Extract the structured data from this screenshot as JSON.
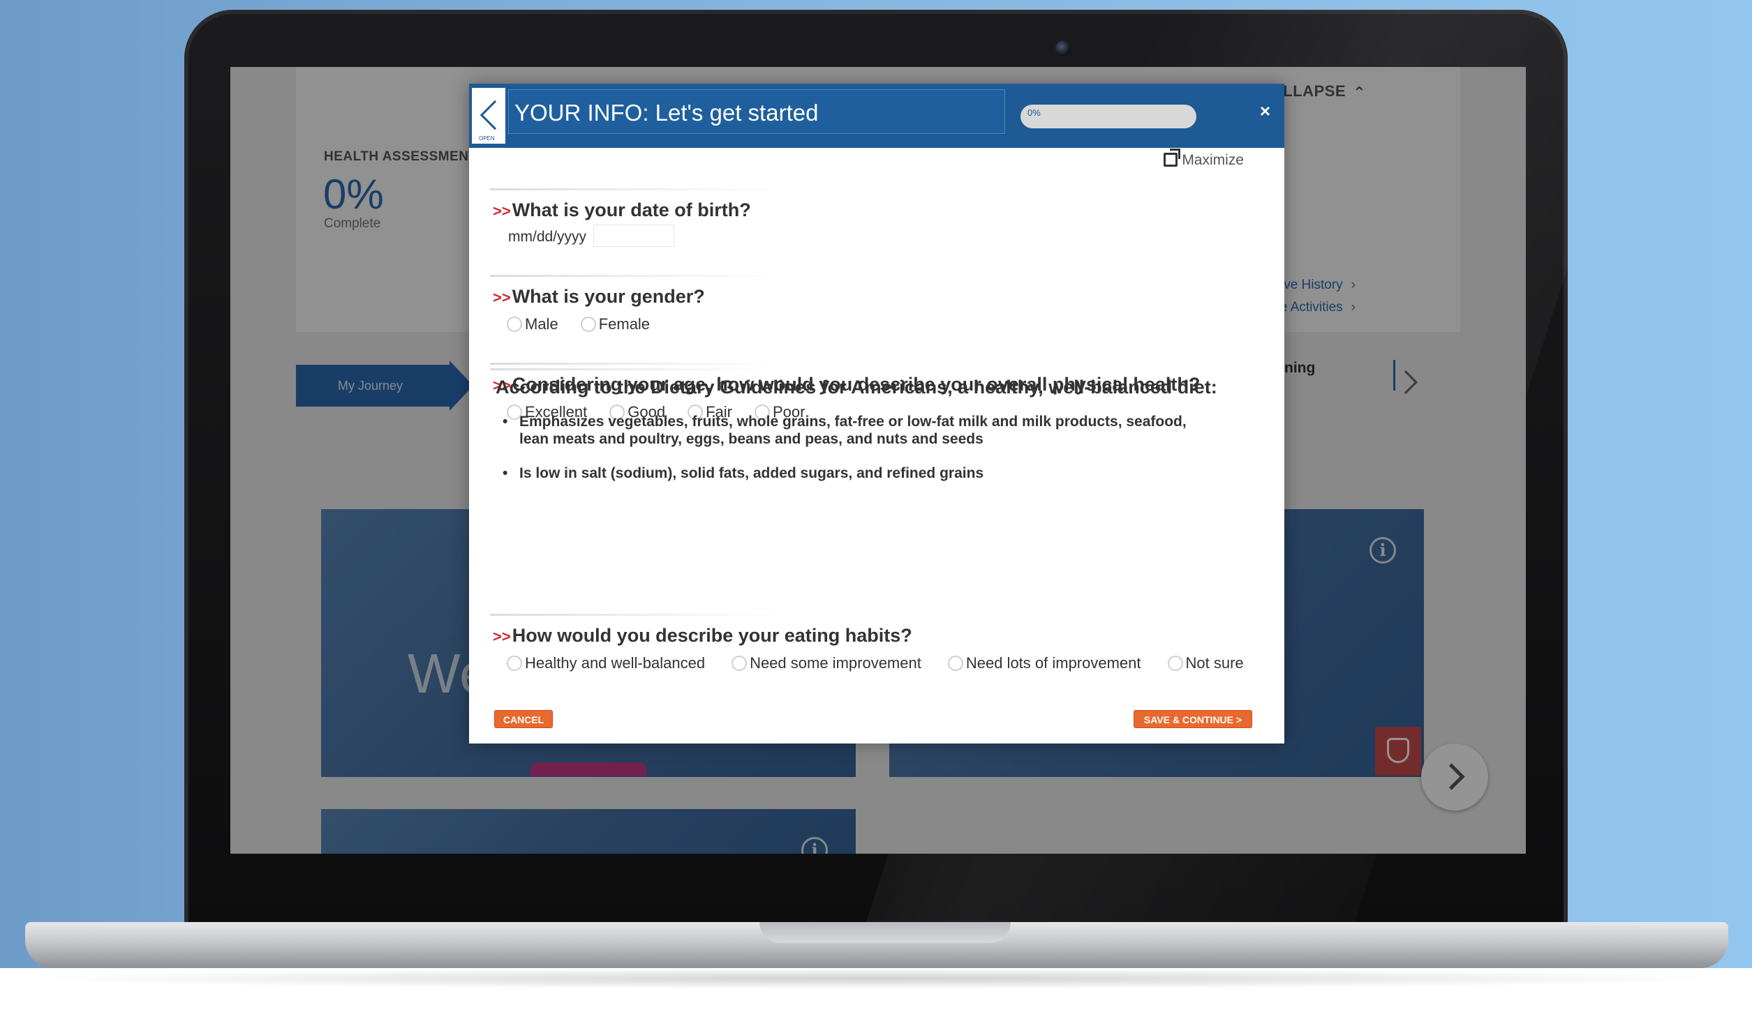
{
  "background_app": {
    "collapse_label": "COLLAPSE",
    "health_assessment_label": "HEALTH ASSESSMENT",
    "percent_complete": "0%",
    "complete_label": "Complete",
    "links": [
      "Incentive History",
      "Eligible Activities"
    ],
    "journey_tab": "My Journey",
    "partial_heading": "ning",
    "tile_text": "We"
  },
  "modal": {
    "title": "YOUR INFO: Let's get started",
    "back_label": "OPEN",
    "progress": {
      "label": "0%",
      "value": 0
    },
    "close_label": "×",
    "maximize_label": "Maximize",
    "questions": {
      "dob": {
        "mark": ">>",
        "text": "What is your date of birth?",
        "format_label": "mm/dd/yyyy",
        "value": ""
      },
      "gender": {
        "mark": ">>",
        "text": "What is your gender?",
        "options": [
          "Male",
          "Female"
        ]
      },
      "health": {
        "mark": ">>",
        "text": "Considering your age, how would you describe your overall physical health?",
        "options": [
          "Excellent",
          "Good",
          "Fair",
          "Poor"
        ]
      },
      "eating": {
        "mark": ">>",
        "text": "How would you describe your eating habits?",
        "options": [
          "Healthy and well-balanced",
          "Need some improvement",
          "Need lots of improvement",
          "Not sure"
        ]
      }
    },
    "guidelines": {
      "title": "According to the Dietary Guidelines for Americans, a healthy, well-balanced diet:",
      "bullets": [
        "Emphasizes vegetables, fruits, whole grains, fat-free or low-fat milk and milk products, seafood, lean meats and poultry, eggs, beans and peas, and nuts and seeds",
        "Is low in salt (sodium), solid fats, added sugars, and refined grains"
      ]
    },
    "buttons": {
      "cancel": "CANCEL",
      "save": "SAVE & CONTINUE >"
    }
  }
}
